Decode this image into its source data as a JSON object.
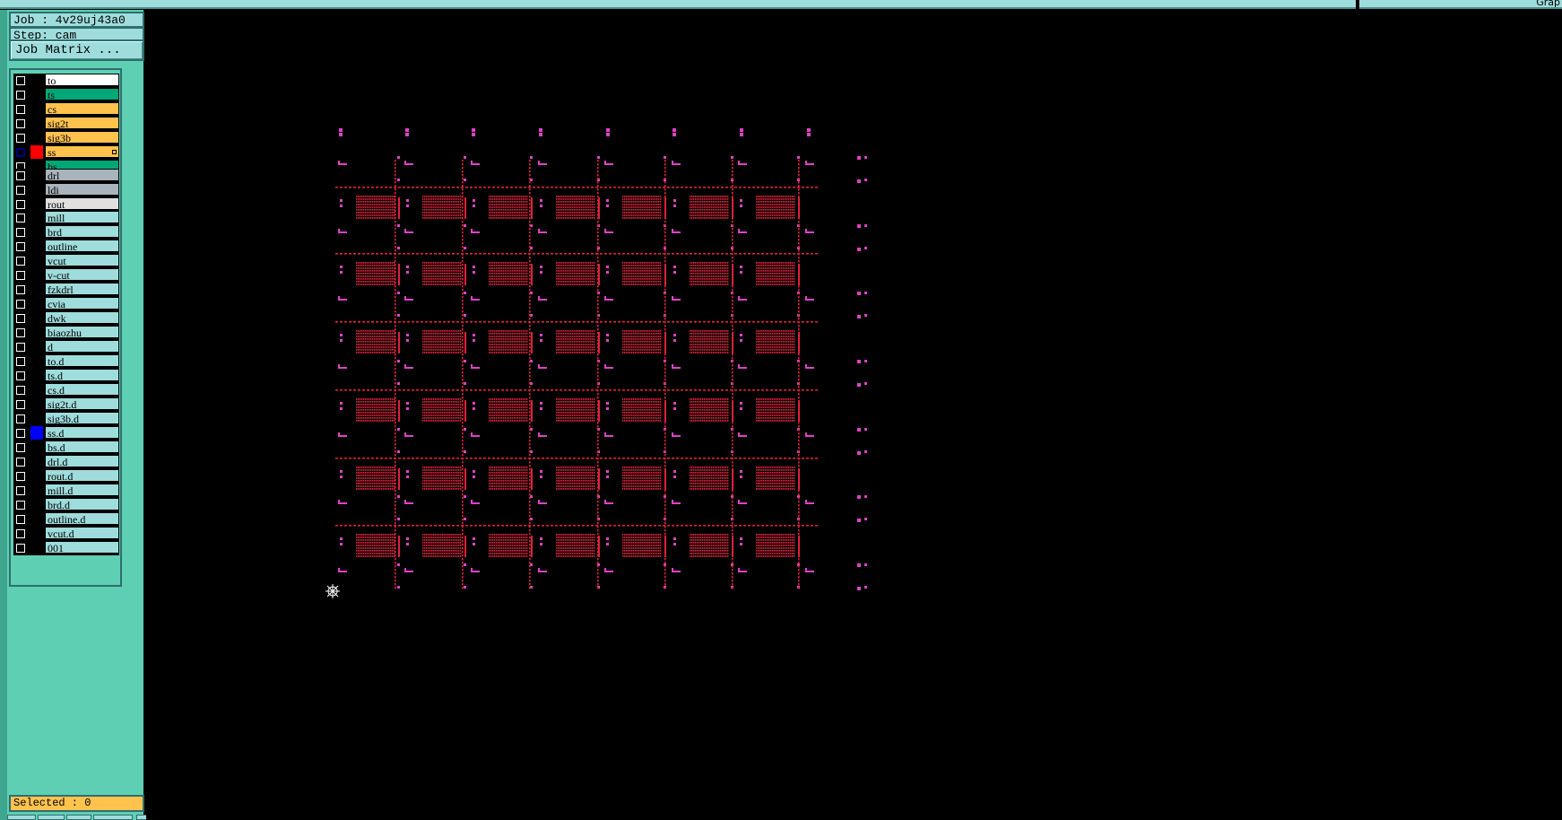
{
  "header": {
    "corner_text": "Grap"
  },
  "job": {
    "label": "Job : 4v29uj43a0",
    "step": "Step: cam"
  },
  "job_matrix_button": "Job Matrix ...",
  "layer_groups": [
    [
      {
        "name": "to",
        "bg": "#ffffff",
        "color": "#000000"
      },
      {
        "name": "ts",
        "bg": "#00a878",
        "color": "#000000"
      },
      {
        "name": "cs",
        "bg": "#ffc24d",
        "color": "#000000"
      },
      {
        "name": "sig2t",
        "bg": "#ffc24d",
        "color": "#000000"
      },
      {
        "name": "sig3b",
        "bg": "#ffc24d",
        "color": "#000000"
      },
      {
        "name": "ss",
        "bg": "#ffc24d",
        "color": "#000000",
        "active": true,
        "swatch": "#ff0000"
      },
      {
        "name": "bs",
        "bg": "#00a878",
        "color": "#000000"
      }
    ],
    [
      {
        "name": "drl",
        "bg": "#a9b4bc",
        "color": "#000000"
      },
      {
        "name": "ldi",
        "bg": "#a9b4bc",
        "color": "#000000"
      },
      {
        "name": "rout",
        "bg": "#e0e0e0",
        "color": "#000000"
      }
    ],
    [
      {
        "name": "mill",
        "bg": "#9fdcdc"
      },
      {
        "name": "brd",
        "bg": "#9fdcdc"
      },
      {
        "name": "outline",
        "bg": "#9fdcdc"
      },
      {
        "name": "vcut",
        "bg": "#9fdcdc"
      },
      {
        "name": "v-cut",
        "bg": "#9fdcdc"
      },
      {
        "name": "fzkdrl",
        "bg": "#9fdcdc"
      },
      {
        "name": "cvia",
        "bg": "#9fdcdc"
      },
      {
        "name": "dwk",
        "bg": "#9fdcdc"
      },
      {
        "name": "biaozhu",
        "bg": "#9fdcdc"
      },
      {
        "name": "d",
        "bg": "#9fdcdc"
      },
      {
        "name": "to.d",
        "bg": "#9fdcdc"
      },
      {
        "name": "ts.d",
        "bg": "#9fdcdc"
      },
      {
        "name": "cs.d",
        "bg": "#9fdcdc"
      },
      {
        "name": "sig2t.d",
        "bg": "#9fdcdc"
      },
      {
        "name": "sig3b.d",
        "bg": "#9fdcdc"
      },
      {
        "name": "ss.d",
        "bg": "#9fdcdc",
        "swatch": "#0000ff"
      },
      {
        "name": "bs.d",
        "bg": "#9fdcdc"
      },
      {
        "name": "drl.d",
        "bg": "#9fdcdc"
      },
      {
        "name": "rout.d",
        "bg": "#9fdcdc"
      },
      {
        "name": "mill.d",
        "bg": "#9fdcdc"
      },
      {
        "name": "brd.d",
        "bg": "#9fdcdc"
      },
      {
        "name": "outline.d",
        "bg": "#9fdcdc"
      },
      {
        "name": "vcut.d",
        "bg": "#9fdcdc"
      },
      {
        "name": "001",
        "bg": "#9fdcdc"
      }
    ]
  ],
  "status": {
    "selected": "Selected : 0"
  },
  "colors": {
    "pad": "#e0203a",
    "marker": "#e040c8",
    "panel": "#5fcfb4",
    "header": "#9fdcdc",
    "highlight": "#ffc24d"
  },
  "icons": {
    "origin": "origin-crosshair-icon"
  }
}
